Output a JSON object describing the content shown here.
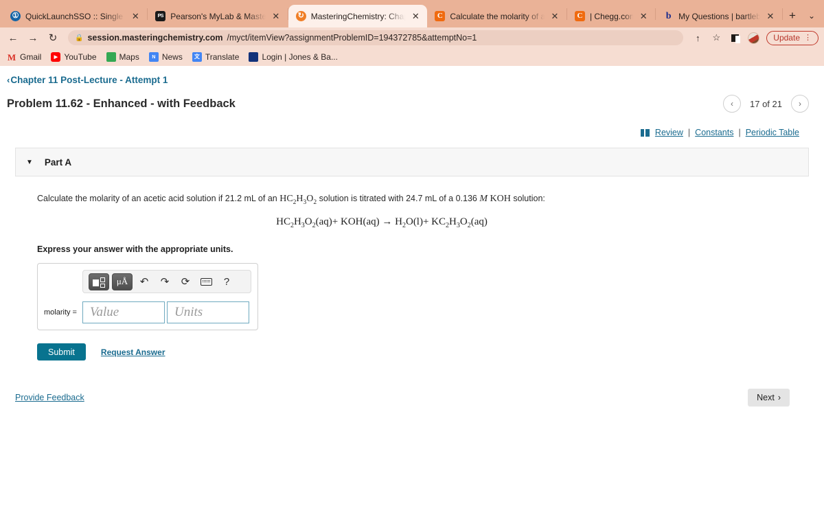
{
  "browser": {
    "tabs": [
      {
        "title": "QuickLaunchSSO :: Single S",
        "favicon": "quicklaunch-icon",
        "glyph": "①",
        "active": false
      },
      {
        "title": "Pearson's MyLab & Masteri",
        "favicon": "pearson-icon",
        "glyph": "PS",
        "active": false
      },
      {
        "title": "MasteringChemistry: Chapt",
        "favicon": "mastering-chemistry-icon",
        "glyph": "↻",
        "active": true
      },
      {
        "title": "Calculate the molarity of an",
        "favicon": "chegg-icon",
        "glyph": "C",
        "active": false
      },
      {
        "title": "| Chegg.com",
        "favicon": "chegg-icon",
        "glyph": "C",
        "active": false
      },
      {
        "title": "My Questions | bartleby",
        "favicon": "bartleby-icon",
        "glyph": "b",
        "active": false
      }
    ],
    "new_tab_label": "+",
    "tab_list_chevron": "⌄",
    "nav": {
      "back": "←",
      "forward": "→",
      "reload": "↻"
    },
    "url": {
      "lock": "🔒",
      "host": "session.masteringchemistry.com",
      "path": "/myct/itemView?assignmentProblemID=194372785&attemptNo=1"
    },
    "omni_actions": {
      "share": "↑",
      "bookmark": "☆"
    },
    "update_label": "Update",
    "kebab": "⋮",
    "bookmarks": [
      {
        "label": "Gmail",
        "icon": "gmail-icon",
        "glyph": "M"
      },
      {
        "label": "YouTube",
        "icon": "youtube-icon",
        "glyph": "▶"
      },
      {
        "label": "Maps",
        "icon": "maps-icon",
        "glyph": "📍"
      },
      {
        "label": "News",
        "icon": "news-icon",
        "glyph": "N"
      },
      {
        "label": "Translate",
        "icon": "translate-icon",
        "glyph": "文"
      },
      {
        "label": "Login | Jones & Ba...",
        "icon": "login-icon",
        "glyph": "👤"
      }
    ]
  },
  "page": {
    "breadcrumb": {
      "chevron": "‹",
      "label": "Chapter 11 Post-Lecture - Attempt 1"
    },
    "title": "Problem 11.62 - Enhanced - with Feedback",
    "pager": {
      "prev": "‹",
      "next": "›",
      "position": "17 of 21"
    },
    "tools": {
      "review": "Review",
      "constants": "Constants",
      "periodic_table": "Periodic Table",
      "separator": "|"
    },
    "part": {
      "caret": "▼",
      "label": "Part A",
      "question_pre": "Calculate the molarity of an acetic acid solution if 21.2 mL of an ",
      "formula_acid": "HC2H3O2",
      "question_mid": " solution is titrated with 24.7 mL of a 0.136 ",
      "molar_symbol": "M",
      "question_post": " KOH solution:",
      "equation": "HC2H3O2(aq) + KOH(aq) → H2O(l) + KC2H3O2(aq)",
      "instruction": "Express your answer with the appropriate units.",
      "toolbar": {
        "template_button": "template-icon",
        "units_button": "μÅ",
        "undo": "↶",
        "redo": "↷",
        "reset": "⟳",
        "keyboard": "keyboard-icon",
        "help": "?"
      },
      "input_label": "molarity =",
      "value_placeholder": "Value",
      "units_placeholder": "Units",
      "value_current": "",
      "units_current": "",
      "submit_label": "Submit",
      "request_answer_label": "Request Answer"
    },
    "footer": {
      "feedback_label": "Provide Feedback",
      "next_label": "Next",
      "next_chevron": "›"
    }
  },
  "colors": {
    "chrome_bg": "#eab297",
    "chrome_toolbar": "#f6ddd2",
    "active_tab": "#fdf0ea",
    "link": "#1a6b8f",
    "submit": "#08738f",
    "update": "#b7352a"
  }
}
